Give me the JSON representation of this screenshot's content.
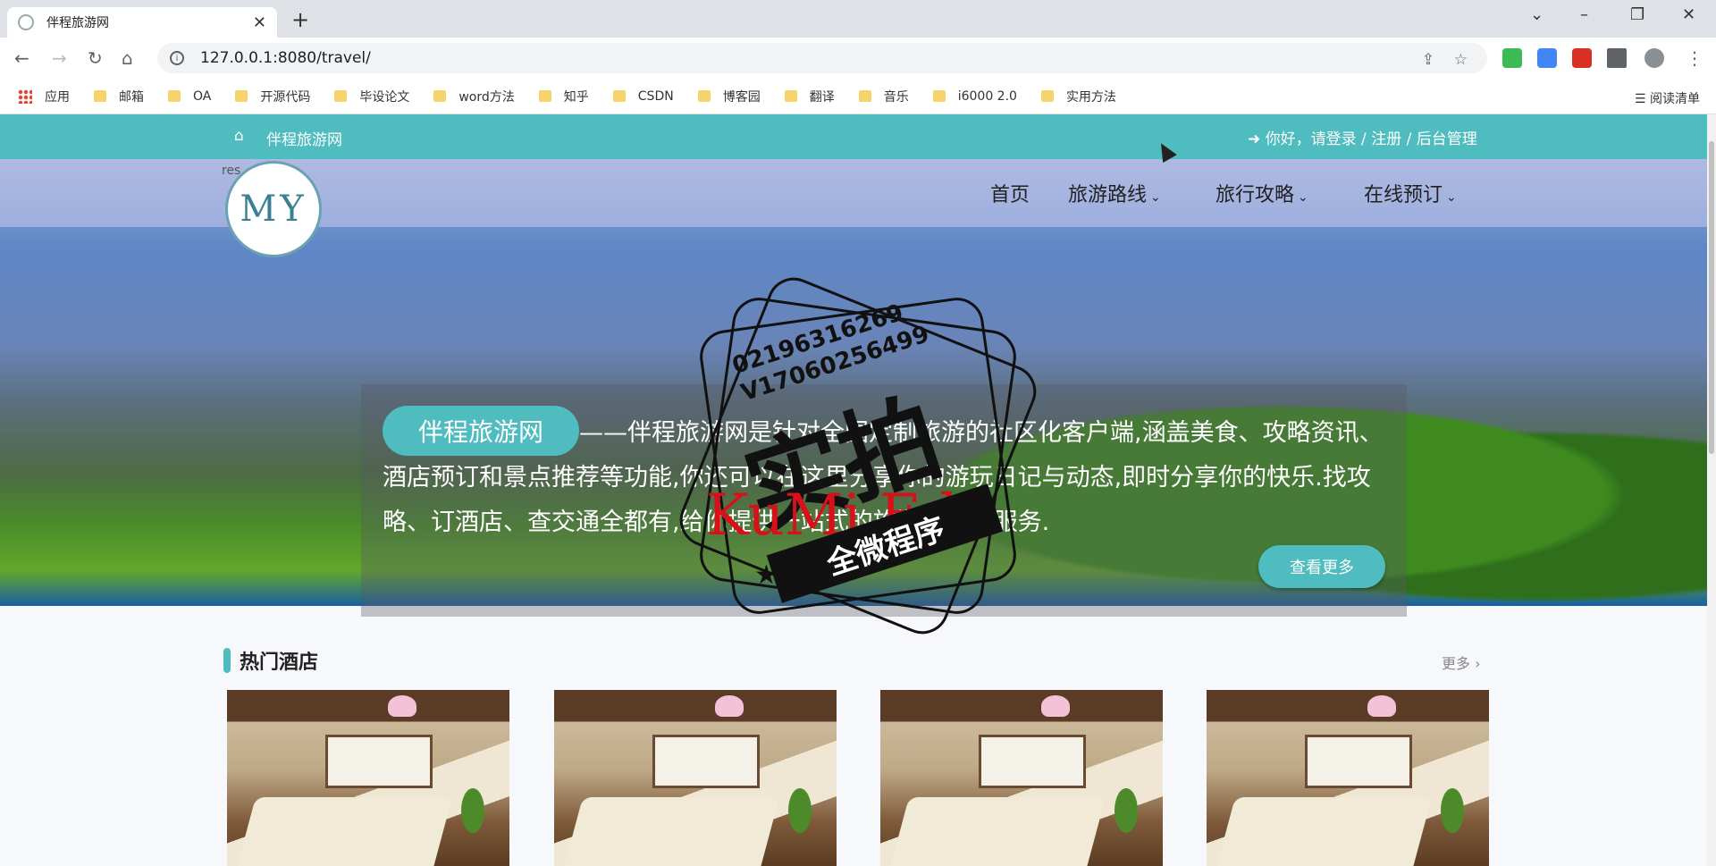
{
  "browser": {
    "tab_title": "伴程旅游网",
    "url": "127.0.0.1:8080/travel/",
    "bookmarks": [
      "应用",
      "邮箱",
      "OA",
      "开源代码",
      "毕设论文",
      "word方法",
      "知乎",
      "CSDN",
      "博客园",
      "翻译",
      "音乐",
      "i6000 2.0",
      "实用方法"
    ],
    "reading_list": "阅读清单"
  },
  "topbar": {
    "home_icon": "⌂",
    "site_name": "伴程旅游网",
    "login_icon": "➜",
    "links": "你好，请登录 / 注册 / 后台管理"
  },
  "header": {
    "logo_text": "MY",
    "res_text": "res",
    "nav": [
      "首页",
      "旅游路线",
      "旅行攻略",
      "在线预订"
    ]
  },
  "intro": {
    "pill": "伴程旅游网",
    "text": "——伴程旅游网是针对全国定制旅游的社区化客户端,涵盖美食、攻略资讯、酒店预订和景点推荐等功能,你还可以在这里分享你的游玩日记与动态,即时分享你的快乐.找攻略、订酒店、查交通全都有,给你提供一站式的旅游社区化服务.",
    "more_button": "查看更多"
  },
  "hotels": {
    "title": "热门酒店",
    "more": "更多 ›",
    "count_cards": 4
  },
  "watermark": {
    "big": "实拍",
    "nums_1": "02196316269",
    "nums_2": "V17060256499",
    "red": "KuMi   Edu",
    "ribbon": "全微程序",
    "star": "★"
  },
  "colors": {
    "accent": "#4fbcbf"
  }
}
